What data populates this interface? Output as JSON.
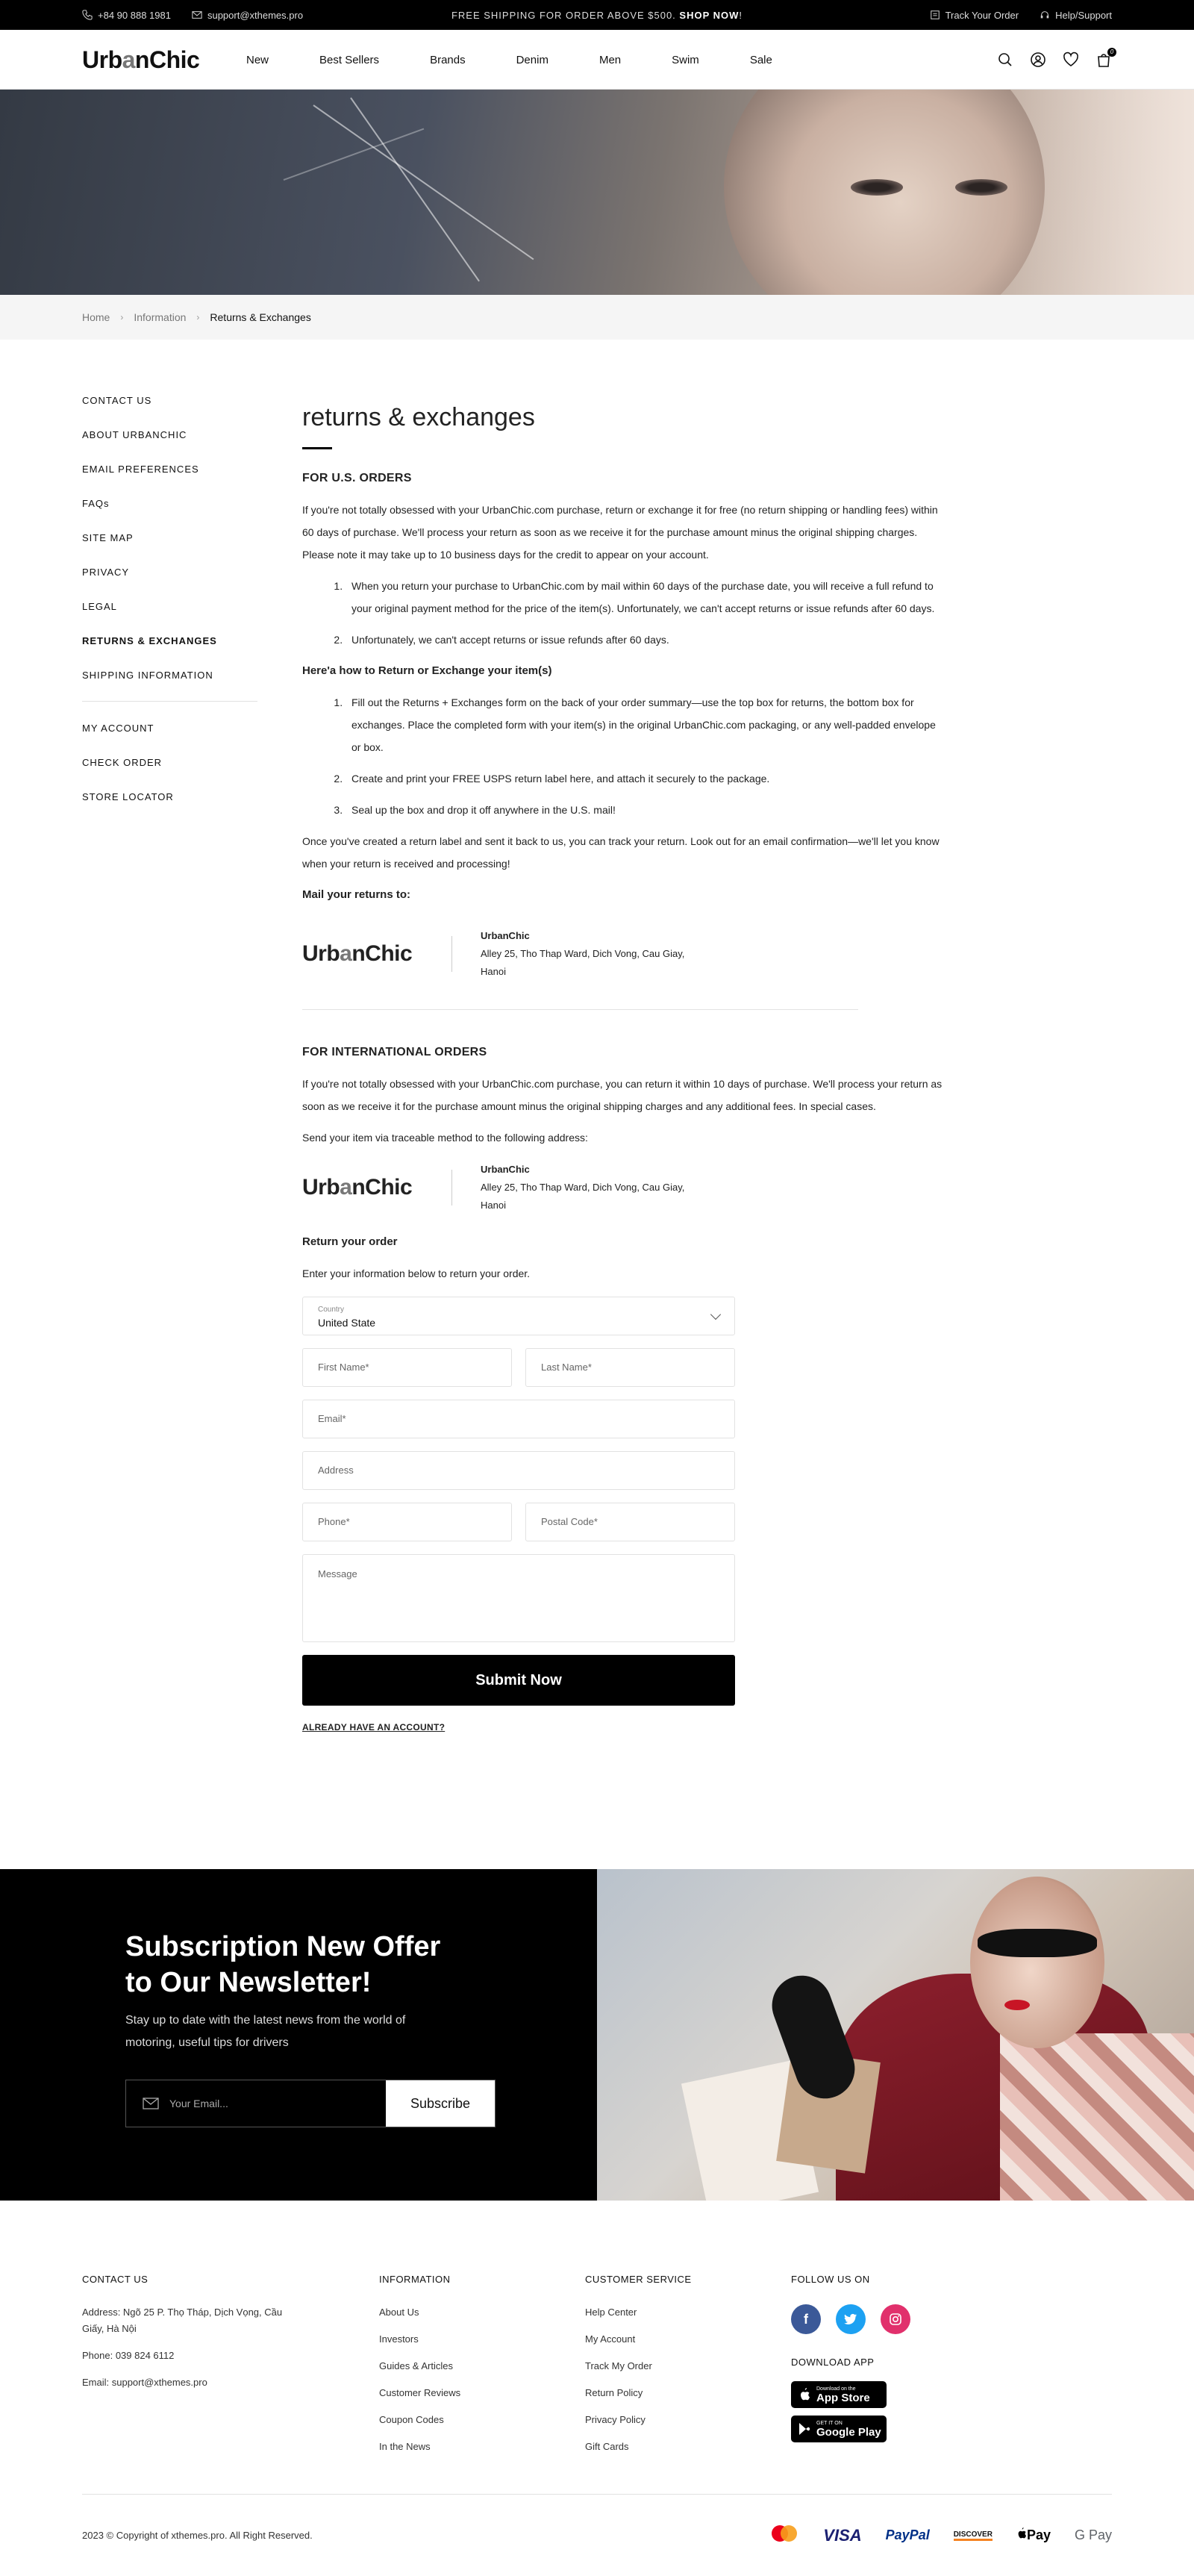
{
  "topbar": {
    "phone": "+84 90 888 1981",
    "email": "support@xthemes.pro",
    "promo_text": "FREE SHIPPING FOR ORDER ABOVE $500.",
    "promo_link": "SHOP NOW",
    "promo_end": "!",
    "track": "Track Your Order",
    "help": "Help/Support"
  },
  "header": {
    "logo_pre": "Urb",
    "logo_a": "a",
    "logo_post": "nChic",
    "nav": [
      "New",
      "Best Sellers",
      "Brands",
      "Denim",
      "Men",
      "Swim",
      "Sale"
    ],
    "cart_count": "0"
  },
  "breadcrumb": [
    "Home",
    "Information",
    "Returns & Exchanges"
  ],
  "sidebar": {
    "group1": [
      "CONTACT US",
      "ABOUT URBANCHIC",
      "EMAIL PREFERENCES",
      "FAQs",
      "SITE MAP",
      "PRIVACY",
      "LEGAL",
      "RETURNS & EXCHANGES",
      "SHIPPING INFORMATION"
    ],
    "group2": [
      "MY ACCOUNT",
      "CHECK ORDER",
      "STORE LOCATOR"
    ]
  },
  "content": {
    "title": "returns & exchanges",
    "us_heading": "FOR U.S. ORDERS",
    "us_p1": "If you're not totally obsessed with your UrbanChic.com purchase, return or exchange it for free (no return shipping or handling fees) within 60 days of purchase. We'll process your return as soon as we receive it for the purchase amount minus the original shipping charges. Please note it may take up to 10 business days for the credit to appear on your account.",
    "us_list": [
      "When you return your purchase to UrbanChic.com by mail within 60 days of the purchase date, you will receive a full refund to your original payment method for the price of the item(s). Unfortunately, we can't accept returns or issue refunds after 60 days.",
      "Unfortunately, we can't accept returns or issue refunds after 60 days."
    ],
    "how_heading": "Here'a how to Return or Exchange your item(s)",
    "how_list": [
      "Fill out the Returns + Exchanges form on the back of your order summary—use the top box for returns, the bottom box for exchanges. Place the completed form with your item(s) in the original UrbanChic.com packaging, or any well-padded envelope or box.",
      "Create and print your FREE USPS return label here, and attach it securely to the package.",
      "Seal up the box and drop it off anywhere in the U.S. mail!"
    ],
    "us_p2": "Once you've created a return label and sent it back to us, you can track your return. Look out for an email confirmation—we'll let you know when your return is received and processing!",
    "mail_heading": "Mail your returns to:",
    "addr_name": "UrbanChic",
    "addr_line1": "Alley 25, Tho Thap Ward, Dich Vong, Cau Giay,",
    "addr_line2": "Hanoi",
    "intl_heading": "FOR INTERNATIONAL ORDERS",
    "intl_p1": "If you're not totally obsessed with your UrbanChic.com purchase, you can return it within 10 days of purchase. We'll process your return as soon as we receive it for the purchase amount minus the original shipping charges and any additional fees. In special cases.",
    "intl_p2": "Send your item via traceable method to the following address:",
    "form_heading": "Return your order",
    "form_intro": "Enter your information below to return your order."
  },
  "form": {
    "country_label": "Country",
    "country_value": "United State",
    "first_name": "First Name*",
    "last_name": "Last Name*",
    "email": "Email*",
    "address": "Address",
    "phone": "Phone*",
    "postal": "Postal Code*",
    "message": "Message",
    "submit": "Submit Now",
    "already": "ALREADY HAVE AN ACCOUNT?"
  },
  "newsletter": {
    "title_line1": "Subscription New Offer",
    "title_line2": "to Our Newsletter!",
    "text": "Stay up to date with the latest news from the world of motoring, useful tips for drivers",
    "placeholder": "Your Email...",
    "button": "Subscribe"
  },
  "footer": {
    "contact_heading": "CONTACT US",
    "address": "Address: Ngõ 25 P. Thọ Tháp, Dịch Vọng, Cầu Giấy, Hà Nội",
    "phone": "Phone: 039 824 6112",
    "email": "Email: support@xthemes.pro",
    "info_heading": "INFORMATION",
    "info_links": [
      "About Us",
      "Investors",
      "Guides & Articles",
      "Customer Reviews",
      "Coupon Codes",
      "In the News"
    ],
    "cs_heading": "CUSTOMER SERVICE",
    "cs_links": [
      "Help Center",
      "My Account",
      "Track My Order",
      "Return Policy",
      "Privacy Policy",
      "Gift Cards"
    ],
    "follow_heading": "FOLLOW US ON",
    "download_heading": "DOWNLOAD APP",
    "appstore_small": "Download on the",
    "appstore_big": "App Store",
    "gplay_small": "GET IT ON",
    "gplay_big": "Google Play",
    "copyright": "2023 © Copyright of xthemes.pro. All Right Reserved.",
    "payments": [
      "VISA",
      "PayPal",
      "DISCOVER",
      "Pay",
      "G Pay"
    ]
  },
  "colors": {
    "accent": "#000000",
    "facebook": "#3b5998",
    "twitter": "#1da1f2",
    "instagram": "#e1306c"
  }
}
